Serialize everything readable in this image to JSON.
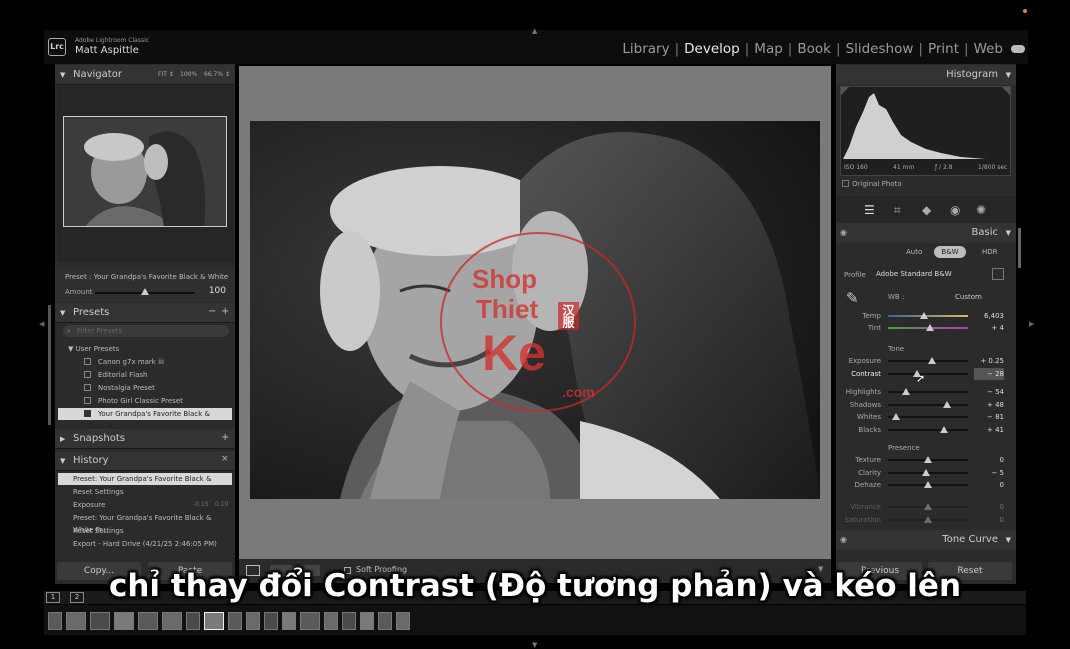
{
  "app": {
    "name": "Adobe Lightroom Classic",
    "user": "Matt Aspittle",
    "logo": "Lrc"
  },
  "modules": [
    "Library",
    "Develop",
    "Map",
    "Book",
    "Slideshow",
    "Print",
    "Web"
  ],
  "active_module": "Develop",
  "navigator": {
    "title": "Navigator",
    "zoom_fit": "FIT ↕",
    "zoom_100": "100%",
    "zoom_667": "66.7% ↕"
  },
  "preset_status": {
    "label": "Preset : Your Grandpa's Favorite Black & White",
    "amount_label": "Amount",
    "amount_value": "100",
    "amount_level": 0.5
  },
  "presets": {
    "title": "Presets",
    "search_placeholder": "Filter Presets",
    "group": "User Presets",
    "items": [
      "Canon g7x mark iii",
      "Editorial Flash",
      "Nostalgia Preset",
      "Photo Girl Classic Preset",
      "Your Grandpa's Favorite Black & White Pr..."
    ]
  },
  "snapshots": {
    "title": "Snapshots"
  },
  "history": {
    "title": "History",
    "items": [
      {
        "label": "Preset: Your Grandpa's Favorite Black & White Pr...",
        "a": "",
        "b": ""
      },
      {
        "label": "Reset Settings",
        "a": "",
        "b": ""
      },
      {
        "label": "Exposure",
        "a": "-0.15",
        "b": "0.10"
      },
      {
        "label": "Preset: Your Grandpa's Favorite Black & White Pr...",
        "a": "",
        "b": ""
      },
      {
        "label": "Reset Settings",
        "a": "",
        "b": ""
      },
      {
        "label": "Export - Hard Drive (4/21/25 2:46:05 PM)",
        "a": "",
        "b": ""
      }
    ]
  },
  "left_buttons": {
    "copy": "Copy...",
    "paste": "Paste"
  },
  "toolbar": {
    "soft_proofing": "Soft Proofing"
  },
  "histogram": {
    "title": "Histogram",
    "iso": "ISO 160",
    "focal": "41 mm",
    "aperture": "ƒ / 2.8",
    "shutter": "1/800 sec",
    "original_photo": "Original Photo"
  },
  "basic": {
    "title": "Basic",
    "treatment": [
      "Auto",
      "B&W",
      "HDR"
    ],
    "profile_label": "Profile",
    "profile_value": "Adobe Standard B&W",
    "wb_label": "WB :",
    "wb_value": "Custom",
    "tone_label": "Tone",
    "presence_label": "Presence",
    "sliders_wb": [
      {
        "label": "Temp",
        "value": "6,403",
        "pos": 0.45
      },
      {
        "label": "Tint",
        "value": "+ 4",
        "pos": 0.52
      }
    ],
    "sliders_tone": [
      {
        "label": "Exposure",
        "value": "+ 0.25",
        "pos": 0.55
      },
      {
        "label": "Contrast",
        "value": "− 28",
        "pos": 0.36
      }
    ],
    "sliders_tone2": [
      {
        "label": "Highlights",
        "value": "− 54",
        "pos": 0.23
      },
      {
        "label": "Shadows",
        "value": "+ 48",
        "pos": 0.74
      },
      {
        "label": "Whites",
        "value": "− 81",
        "pos": 0.1
      },
      {
        "label": "Blacks",
        "value": "+ 41",
        "pos": 0.7
      }
    ],
    "sliders_presence": [
      {
        "label": "Texture",
        "value": "0",
        "pos": 0.5
      },
      {
        "label": "Clarity",
        "value": "− 5",
        "pos": 0.48
      },
      {
        "label": "Dehaze",
        "value": "0",
        "pos": 0.5
      }
    ],
    "sliders_presence2": [
      {
        "label": "Vibrance",
        "value": "0",
        "pos": 0.5
      },
      {
        "label": "Saturation",
        "value": "0",
        "pos": 0.5
      }
    ]
  },
  "tone_curve": {
    "title": "Tone Curve"
  },
  "right_buttons": {
    "previous": "Previous",
    "reset": "Reset"
  },
  "filmstrip_pages": [
    "1",
    "2"
  ],
  "caption": "chỉ thay đổi Contrast (Độ tương phản) và kéo lên",
  "watermark": {
    "line1": "Shop",
    "line2": "Thiet",
    "line3": "Ke",
    "line4": ".com",
    "seal": "汉服"
  }
}
